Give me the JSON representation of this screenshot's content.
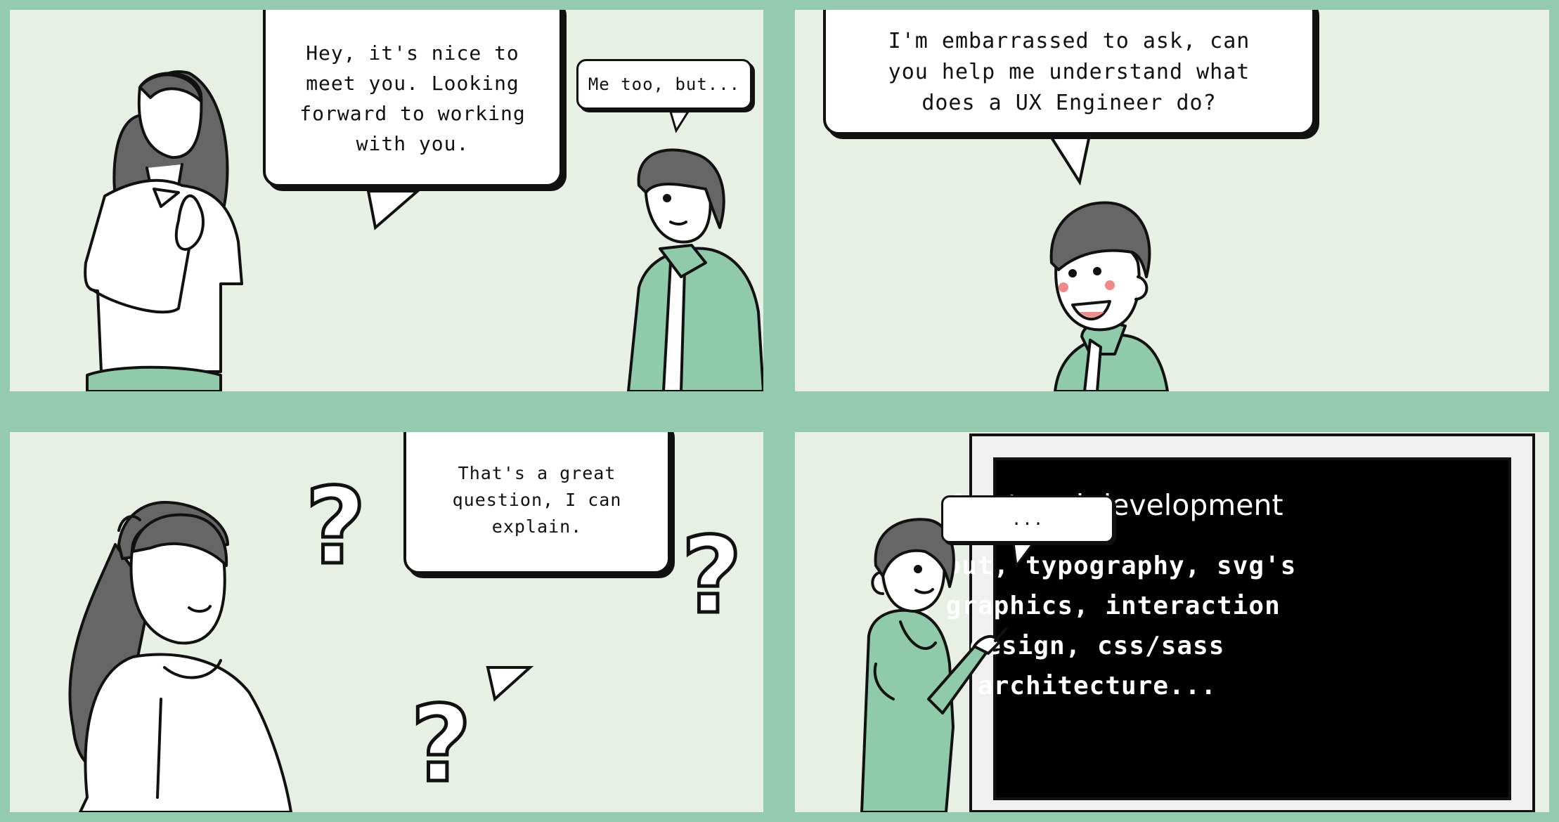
{
  "panels": {
    "p1": {
      "woman_bubble": "Hey, it's nice to\nmeet you. Looking\nforward to working\nwith you.",
      "man_bubble": "Me too, but..."
    },
    "p2": {
      "man_bubble": "I'm embarrassed to ask, can\nyou help me understand what\ndoes a UX Engineer do?"
    },
    "p3": {
      "woman_bubble": "That's a great\nquestion, I can\nexplain.",
      "question_mark": "?"
    },
    "p4": {
      "woman_bubble": "...",
      "board_title": "front-end development",
      "board_text": "Layout, typography, svg's\n& graphics, interaction\ndesign, css/sass\narchitecture..."
    }
  },
  "colors": {
    "frame": "#94cab0",
    "panel_bg": "#e8efe4",
    "jacket_green": "#8fcaaa",
    "hair": "#666666",
    "ink": "#111111",
    "blush": "#f08a8a"
  }
}
